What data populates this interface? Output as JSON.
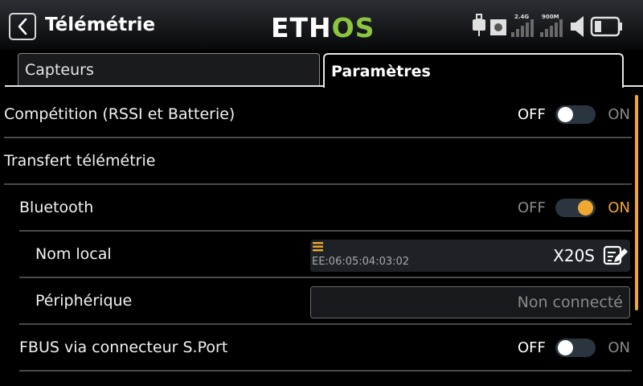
{
  "header": {
    "title": "Télémétrie",
    "logo_part1": "ETH",
    "logo_part2": "OS",
    "signal_24_label": "2.4G",
    "signal_900_label": "900M"
  },
  "tabs": [
    {
      "label": "Capteurs",
      "active": false
    },
    {
      "label": "Paramètres",
      "active": true
    }
  ],
  "settings": {
    "competition": {
      "label": "Compétition (RSSI et Batterie)",
      "off": "OFF",
      "on": "ON",
      "enabled": false
    },
    "transfer": {
      "label": "Transfert télémétrie"
    },
    "bluetooth": {
      "label": "Bluetooth",
      "off": "OFF",
      "on": "ON",
      "enabled": true
    },
    "local_name": {
      "label": "Nom local",
      "mac": "EE:06:05:04:03:02",
      "value": "X20S"
    },
    "peripheral": {
      "label": "Périphérique",
      "value": "Non connecté"
    },
    "fbus": {
      "label": "FBUS via connecteur S.Port",
      "off": "OFF",
      "on": "ON",
      "enabled": false
    }
  },
  "colors": {
    "accent": "#f0a830",
    "logo_green": "#8cc63f",
    "toggle_track": "#2a3540"
  },
  "icons": [
    "chevron-left-icon",
    "usb-icon",
    "record-icon",
    "signal-icon",
    "speaker-icon",
    "battery-icon",
    "menu-lines-icon",
    "edit-icon"
  ]
}
